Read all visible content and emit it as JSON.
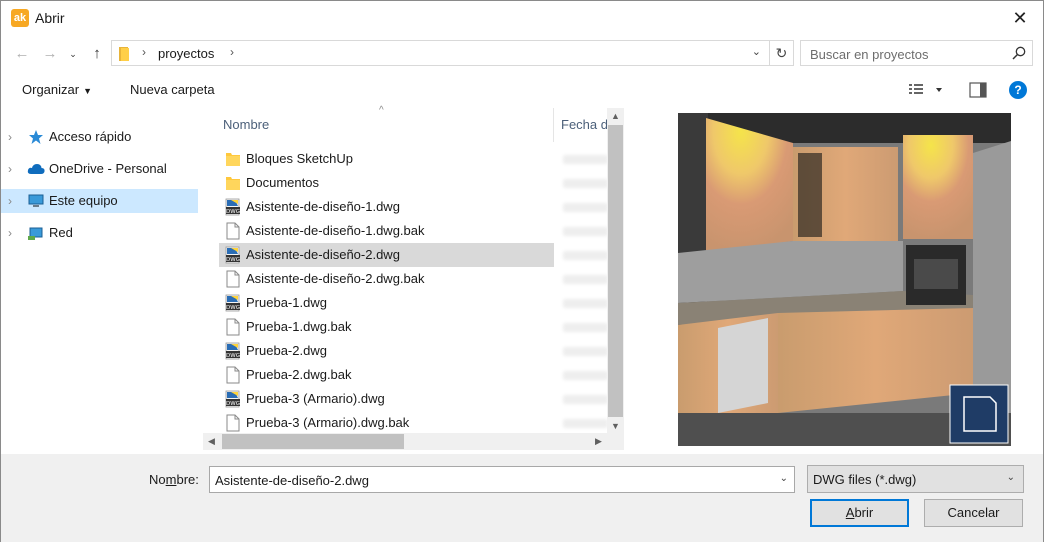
{
  "window": {
    "title": "Abrir",
    "app_icon_text": "ak"
  },
  "address": {
    "path": "proyectos"
  },
  "search": {
    "placeholder": "Buscar en proyectos"
  },
  "toolbar": {
    "organize": "Organizar",
    "new_folder": "Nueva carpeta"
  },
  "navpane": {
    "items": [
      {
        "label": "Acceso rápido"
      },
      {
        "label": "OneDrive - Personal"
      },
      {
        "label": "Este equipo"
      },
      {
        "label": "Red"
      }
    ]
  },
  "columns": {
    "name": "Nombre",
    "date": "Fecha d"
  },
  "files": [
    {
      "name": "Bloques SketchUp",
      "type": "folder"
    },
    {
      "name": "Documentos",
      "type": "folder"
    },
    {
      "name": "Asistente-de-diseño-1.dwg",
      "type": "dwg"
    },
    {
      "name": "Asistente-de-diseño-1.dwg.bak",
      "type": "bak"
    },
    {
      "name": "Asistente-de-diseño-2.dwg",
      "type": "dwg"
    },
    {
      "name": "Asistente-de-diseño-2.dwg.bak",
      "type": "bak"
    },
    {
      "name": "Prueba-1.dwg",
      "type": "dwg"
    },
    {
      "name": "Prueba-1.dwg.bak",
      "type": "bak"
    },
    {
      "name": "Prueba-2.dwg",
      "type": "dwg"
    },
    {
      "name": "Prueba-2.dwg.bak",
      "type": "bak"
    },
    {
      "name": "Prueba-3 (Armario).dwg",
      "type": "dwg"
    },
    {
      "name": "Prueba-3 (Armario).dwg.bak",
      "type": "bak"
    }
  ],
  "selected_file": "Asistente-de-diseño-2.dwg",
  "bottom": {
    "name_label_prefix": "No",
    "name_label_underlined": "m",
    "name_label_suffix": "bre:",
    "filename": "Asistente-de-diseño-2.dwg",
    "filetype": "DWG files (*.dwg)",
    "open_prefix": "",
    "open_underlined": "A",
    "open_suffix": "brir",
    "cancel": "Cancelar"
  },
  "colors": {
    "accent": "#0078d7",
    "selection": "#cce8ff",
    "folder": "#ffc83d"
  }
}
